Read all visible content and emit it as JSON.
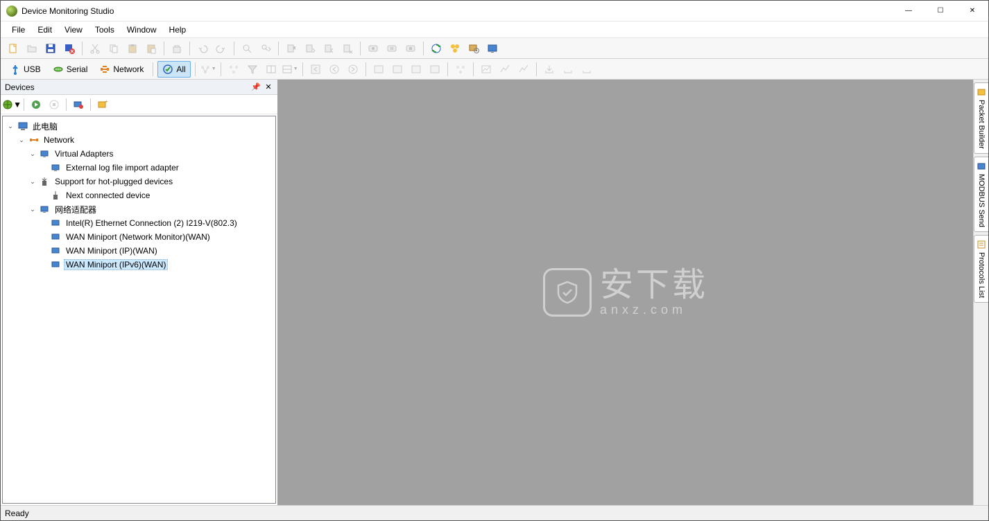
{
  "app": {
    "title": "Device Monitoring Studio"
  },
  "window_controls": {
    "min": "—",
    "max": "☐",
    "close": "✕"
  },
  "menu": [
    "File",
    "Edit",
    "View",
    "Tools",
    "Window",
    "Help"
  ],
  "filter_buttons": {
    "usb": "USB",
    "serial": "Serial",
    "network": "Network",
    "all": "All"
  },
  "devices_panel": {
    "title": "Devices"
  },
  "tree": {
    "root": "此电脑",
    "network": "Network",
    "virtual_adapters": "Virtual Adapters",
    "ext_log_adapter": "External log file import adapter",
    "hotplug": "Support for hot-plugged devices",
    "next_connected": "Next connected device",
    "net_adapters": "网络适配器",
    "intel": "Intel(R) Ethernet Connection (2) I219-V(802.3)",
    "wan_monitor": "WAN Miniport (Network Monitor)(WAN)",
    "wan_ip": "WAN Miniport (IP)(WAN)",
    "wan_ipv6": "WAN Miniport (IPv6)(WAN)"
  },
  "right_tabs": {
    "packet_builder": "Packet Builder",
    "modbus_send": "MODBUS Send",
    "protocols_list": "Protocols List"
  },
  "status": {
    "text": "Ready"
  },
  "watermark": {
    "main": "安下载",
    "sub": "anxz.com"
  }
}
